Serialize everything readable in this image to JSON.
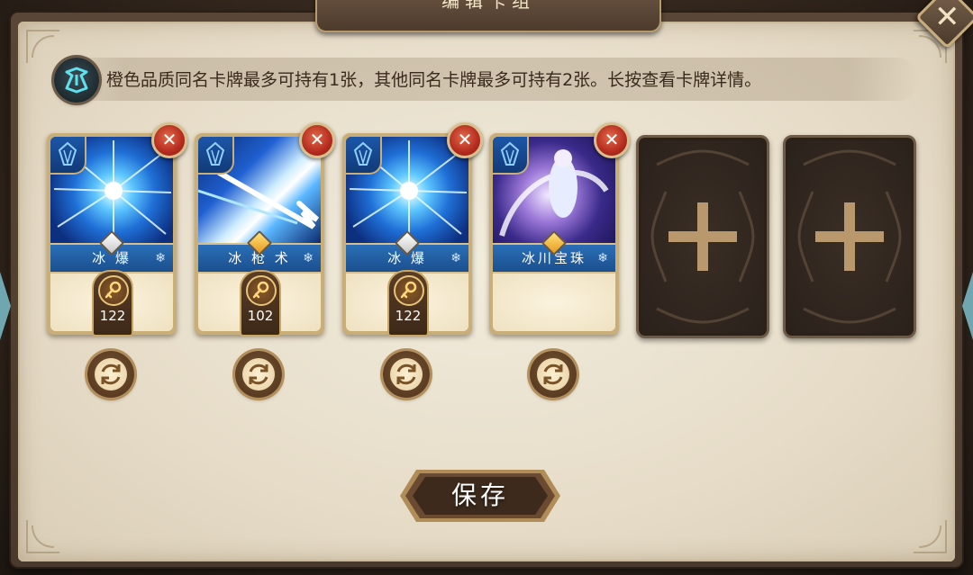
{
  "dialog": {
    "title": "编辑卡组",
    "close_glyph": "✕",
    "info_text": "橙色品质同名卡牌最多可持有1张，其他同名卡牌最多可持有2张。长按查看卡牌详情。",
    "save_label": "保存"
  },
  "deck": {
    "cards": [
      {
        "name": "冰 爆",
        "cost": "122",
        "rarity": "white",
        "art": "ice-burst",
        "remove_glyph": "✕"
      },
      {
        "name": "冰 枪 术",
        "cost": "102",
        "rarity": "gold",
        "art": "ice-lance",
        "remove_glyph": "✕"
      },
      {
        "name": "冰 爆",
        "cost": "122",
        "rarity": "white",
        "art": "ice-burst",
        "remove_glyph": "✕"
      },
      {
        "name": "冰川宝珠",
        "cost": "",
        "rarity": "gold",
        "art": "glacier",
        "remove_glyph": "✕"
      }
    ],
    "empty_slots": 2
  },
  "icons": {
    "info": "rune-icon",
    "element": "crystal-icon",
    "cost": "key-icon",
    "swap": "swap-icon",
    "add": "plus-icon",
    "element_mark": "❄"
  },
  "colors": {
    "accent_gold": "#c9ae78",
    "card_band_blue": "#2a6fb8",
    "remove_red": "#b42b1f",
    "parchment": "#e6dcc8"
  }
}
